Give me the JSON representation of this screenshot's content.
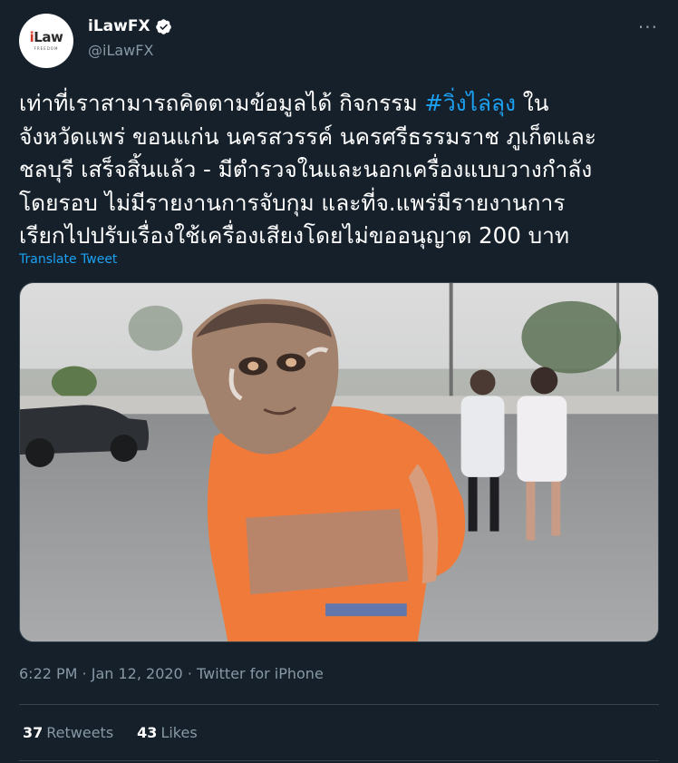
{
  "author": {
    "display_name": "iLawFX",
    "handle": "@iLawFX",
    "avatar_text": "iLaw",
    "avatar_subtext": "FREEDOM"
  },
  "menu": {
    "more_label": "···"
  },
  "tweet": {
    "text_before": "เท่าที่เราสามารถคิดตามข้อมูลได้ กิจกรรม ",
    "hashtag": "#วิ่งไล่ลุง",
    "text_after": " ใน\nจังหวัดแพร่ ขอนแก่น นครสวรรค์ นครศรีธรรมราช ภูเก็ตและ\nชลบุรี เสร็จสิ้นแล้ว - มีตำรวจในและนอกเครื่องแบบวางกำลัง\nโดยรอบ ไม่มีรายงานการจับกุม  และที่จ.แพร่มีรายงานการ\nเรียกไปปรับเรื่องใช้เครื่องเสียงโดยไม่ขออนุญาต 200 บาท",
    "translate_label": "Translate Tweet"
  },
  "timestamp": "6:22 PM · Jan 12, 2020 · Twitter for iPhone",
  "stats": {
    "retweets_count": "37",
    "retweets_label": "Retweets",
    "likes_count": "43",
    "likes_label": "Likes"
  },
  "colors": {
    "background": "#15202b",
    "accent": "#1da1f2",
    "secondary_text": "#8899a6",
    "divider": "#38444d"
  },
  "icons": {
    "verified": "verified-badge-icon",
    "more": "more-icon"
  }
}
